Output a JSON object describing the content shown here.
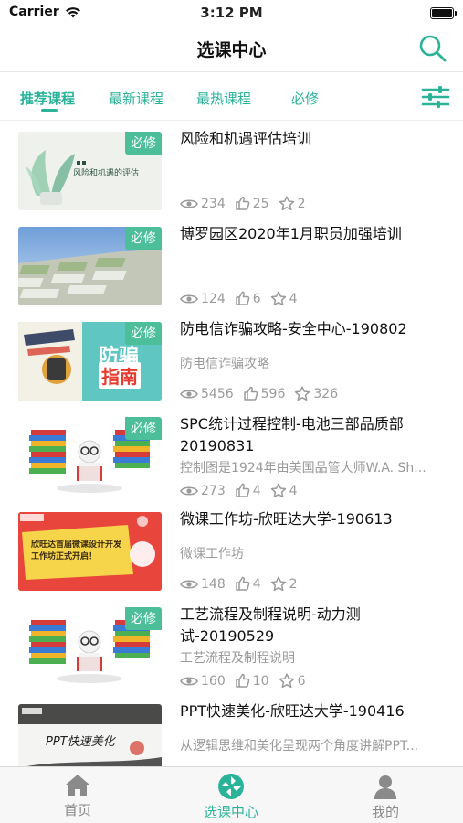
{
  "status": {
    "carrier": "Carrier",
    "time": "3:12 PM"
  },
  "navbar": {
    "title": "选课中心"
  },
  "tabs": [
    {
      "label": "推荐课程",
      "active": true
    },
    {
      "label": "最新课程",
      "active": false
    },
    {
      "label": "最热课程",
      "active": false
    },
    {
      "label": "必修",
      "active": false
    }
  ],
  "courses": [
    {
      "title": "风险和机遇评估培训",
      "subtitle": "",
      "badge": "必修",
      "views": "234",
      "likes": "25",
      "stars": "2",
      "thumb_text": "风险和机遇的评估"
    },
    {
      "title": "博罗园区2020年1月职员加强培训",
      "subtitle": "",
      "badge": "必修",
      "views": "124",
      "likes": "6",
      "stars": "4"
    },
    {
      "title": "防电信诈骗攻略-安全中心-190802",
      "subtitle": "防电信诈骗攻略",
      "badge": "必修",
      "views": "5456",
      "likes": "596",
      "stars": "326",
      "thumb_text_1": "防骗",
      "thumb_text_2": "指南"
    },
    {
      "title": "SPC统计过程控制-电池三部品质部20190831",
      "subtitle": "控制图是1924年由美国品管大师W.A. Sh...",
      "badge": "必修",
      "views": "273",
      "likes": "4",
      "stars": "4"
    },
    {
      "title": "微课工作坊-欣旺达大学-190613",
      "subtitle": "微课工作坊",
      "badge": "",
      "views": "148",
      "likes": "4",
      "stars": "2",
      "thumb_text": "欣旺达首届微课设计开发工作坊正式开启！"
    },
    {
      "title": "工艺流程及制程说明-动力测试-20190529",
      "subtitle": "工艺流程及制程说明",
      "badge": "必修",
      "views": "160",
      "likes": "10",
      "stars": "6"
    },
    {
      "title": "PPT快速美化-欣旺达大学-190416",
      "subtitle": "从逻辑思维和美化呈现两个角度讲解PPT...",
      "badge": "",
      "views": "",
      "likes": "",
      "stars": "",
      "thumb_text": "PPT快速美化"
    }
  ],
  "tabbar": [
    {
      "label": "首页",
      "icon": "home-icon",
      "active": false
    },
    {
      "label": "选课中心",
      "icon": "aperture-icon",
      "active": true
    },
    {
      "label": "我的",
      "icon": "person-icon",
      "active": false
    }
  ],
  "colors": {
    "accent": "#2bb39a",
    "badge": "#4cbf9a",
    "meta": "#9a9a9a"
  }
}
